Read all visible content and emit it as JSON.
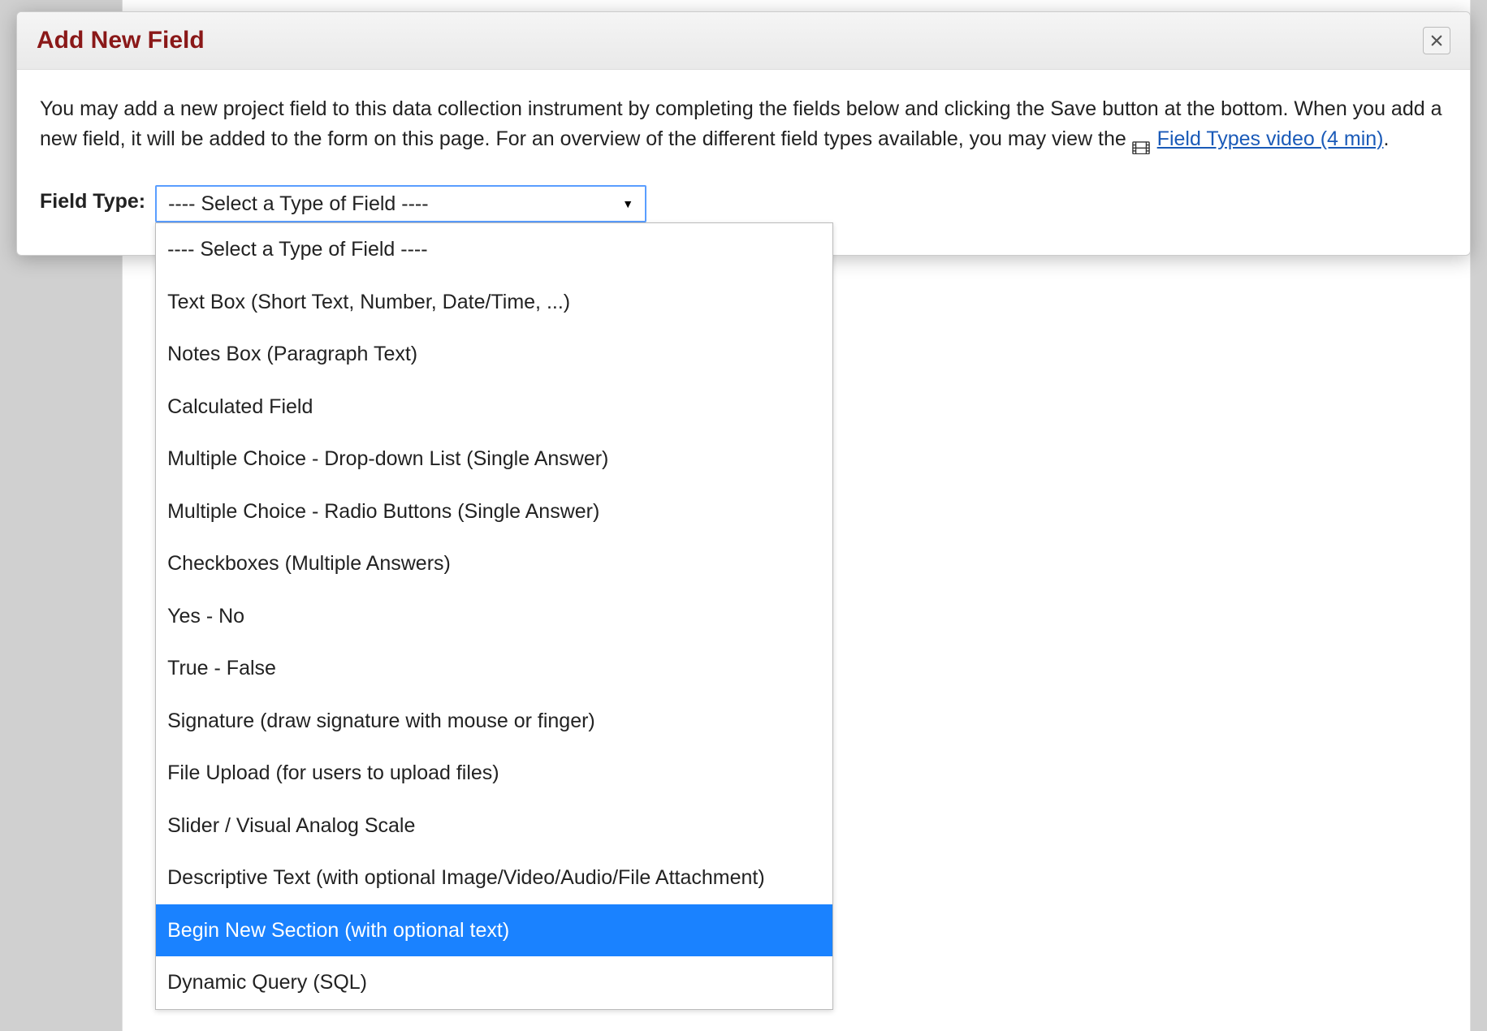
{
  "modal": {
    "title": "Add New Field",
    "intro_part1": "You may add a new project field to this data collection instrument by completing the fields below and clicking the Save button at the bottom. When you add a new field, it will be added to the form on this page. For an overview of the different field types available, you may view the ",
    "video_link_text": "Field Types video (4 min)",
    "intro_part2": ".",
    "field_type_label": "Field Type:",
    "select": {
      "placeholder": "---- Select a Type of Field ----",
      "options": [
        "---- Select a Type of Field ----",
        "Text Box (Short Text, Number, Date/Time, ...)",
        "Notes Box (Paragraph Text)",
        "Calculated Field",
        "Multiple Choice - Drop-down List (Single Answer)",
        "Multiple Choice - Radio Buttons (Single Answer)",
        "Checkboxes (Multiple Answers)",
        "Yes - No",
        "True - False",
        "Signature (draw signature with mouse or finger)",
        "File Upload (for users to upload files)",
        "Slider / Visual Analog Scale",
        "Descriptive Text (with optional Image/Video/Audio/File Attachment)",
        "Begin New Section (with optional text)",
        "Dynamic Query (SQL)"
      ],
      "highlighted_index": 13
    }
  }
}
